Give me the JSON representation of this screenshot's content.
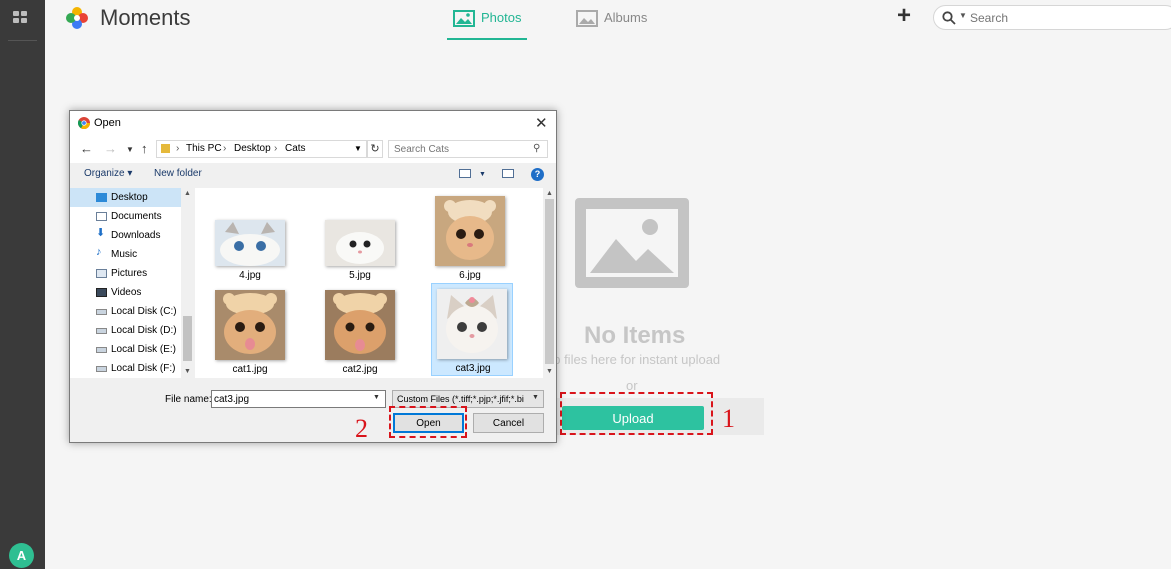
{
  "app": {
    "title": "Moments"
  },
  "sidebar": {
    "avatar_letter": "A",
    "avatar_color": "#2fbf92"
  },
  "tabs": [
    {
      "label": "Photos",
      "active": true
    },
    {
      "label": "Albums",
      "active": false
    }
  ],
  "search": {
    "placeholder": "Search"
  },
  "colors": {
    "accent": "#22b694",
    "upload_button": "#2dc2a0",
    "callout": "#d9141b",
    "sidebar": "#3a3a3a"
  },
  "empty_state": {
    "title": "No Items",
    "subtitle": "op files here for instant upload",
    "or_text": "or",
    "upload_label": "Upload"
  },
  "callouts": {
    "one": "1",
    "two": "2"
  },
  "dialog": {
    "title": "Open",
    "breadcrumb": [
      "This PC",
      "Desktop",
      "Cats"
    ],
    "search_placeholder": "Search Cats",
    "organize_label": "Organize ▾",
    "new_folder_label": "New folder",
    "nav_items": [
      {
        "label": "Desktop",
        "icon": "desktop-icon",
        "selected": true
      },
      {
        "label": "Documents",
        "icon": "documents-icon"
      },
      {
        "label": "Downloads",
        "icon": "downloads-icon"
      },
      {
        "label": "Music",
        "icon": "music-icon"
      },
      {
        "label": "Pictures",
        "icon": "pictures-icon"
      },
      {
        "label": "Videos",
        "icon": "videos-icon"
      },
      {
        "label": "Local Disk (C:)",
        "icon": "drive-icon"
      },
      {
        "label": "Local Disk (D:)",
        "icon": "drive-icon"
      },
      {
        "label": "Local Disk (E:)",
        "icon": "drive-icon"
      },
      {
        "label": "Local Disk (F:)",
        "icon": "drive-icon"
      }
    ],
    "files": [
      {
        "name": "4.jpg",
        "selected": false
      },
      {
        "name": "5.jpg",
        "selected": false
      },
      {
        "name": "6.jpg",
        "selected": false
      },
      {
        "name": "cat1.jpg",
        "selected": false
      },
      {
        "name": "cat2.jpg",
        "selected": false
      },
      {
        "name": "cat3.jpg",
        "selected": true
      }
    ],
    "file_name_label": "File name:",
    "file_name_value": "cat3.jpg",
    "file_type_value": "Custom Files (*.tiff;*.pjp;*.jfif;*.bi",
    "open_label": "Open",
    "cancel_label": "Cancel"
  }
}
